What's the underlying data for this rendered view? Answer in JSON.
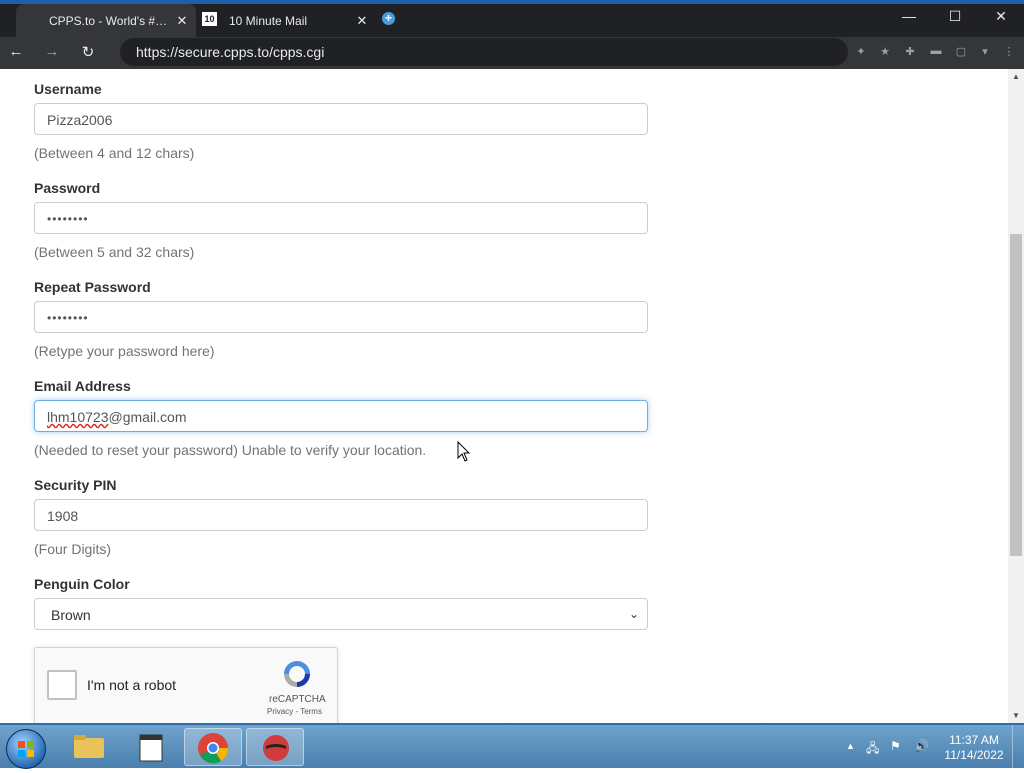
{
  "browser": {
    "tabs": [
      {
        "title": "CPPS.to - World's #…",
        "close": "✕"
      },
      {
        "favicon_text": "10",
        "title": "10 Minute Mail",
        "close": "✕"
      }
    ],
    "new_tab": "+",
    "window_controls": {
      "minimize": "—",
      "maximize": "☐",
      "close": "✕"
    },
    "nav": {
      "back": "←",
      "forward": "→",
      "reload": "↻"
    },
    "url": "https://secure.cpps.to/cpps.cgi"
  },
  "form": {
    "username": {
      "label": "Username",
      "value": "Pizza2006",
      "help": "(Between 4 and 12 chars)"
    },
    "password": {
      "label": "Password",
      "value": "••••••••",
      "help": "(Between 5 and 32 chars)"
    },
    "repeat_password": {
      "label": "Repeat Password",
      "value": "••••••••",
      "help": "(Retype your password here)"
    },
    "email": {
      "label": "Email Address",
      "value_misspelled": "lhm10723",
      "value_rest": "@gmail.com",
      "help": "(Needed to reset your password) Unable to verify your location."
    },
    "pin": {
      "label": "Security PIN",
      "value": "1908",
      "help": "(Four Digits)"
    },
    "color": {
      "label": "Penguin Color",
      "selected": "Brown"
    }
  },
  "captcha": {
    "text": "I'm not a robot",
    "brand": "reCAPTCHA",
    "links": "Privacy - Terms"
  },
  "taskbar": {
    "time": "11:37 AM",
    "date": "11/14/2022"
  },
  "colors": {
    "focus_border": "#66afe9",
    "tab_bar": "#202124",
    "toolbar": "#35363a",
    "taskbar": "#4a7fae"
  }
}
